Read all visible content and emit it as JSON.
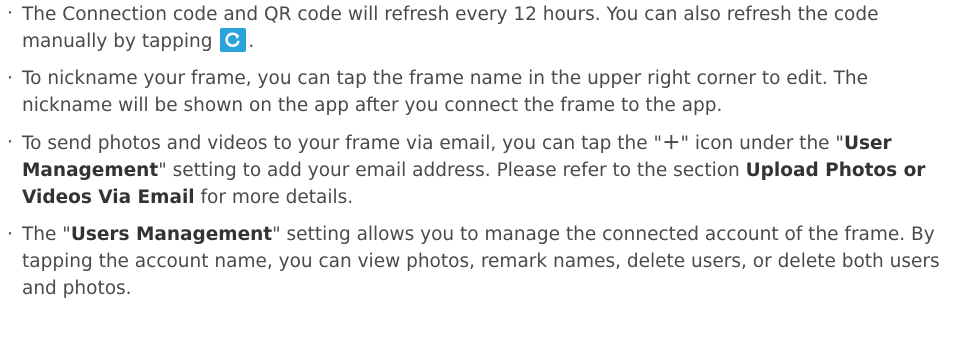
{
  "notes": [
    {
      "before_icon": "The Connection code and QR code will refresh every 12 hours. You can also refresh the code manually by tapping ",
      "icon": "refresh-icon",
      "after_icon": "."
    },
    {
      "text": "To nickname your frame, you can tap the frame name in the upper right corner to edit. The nickname will be shown on the app after you connect the frame to the app."
    },
    {
      "part1": "To send photos and videos to your frame via email, you can tap the \"",
      "plus_symbol": "+",
      "part2": "\" icon under the \"",
      "bold1": "User Management",
      "part3": "\" setting to add your email address. Please refer to the section ",
      "bold2": "Upload Photos or Videos Via Email",
      "part4": " for more details."
    },
    {
      "part1": "The \"",
      "bold1": "Users Management",
      "part2": "\" setting allows you to manage the connected account of the frame. By tapping the account name, you can view photos, remark names, delete users, or delete both users and photos."
    }
  ],
  "bullet_char": "·",
  "colors": {
    "text": "#4a4a4a",
    "icon_bg": "#2aa3dc"
  }
}
